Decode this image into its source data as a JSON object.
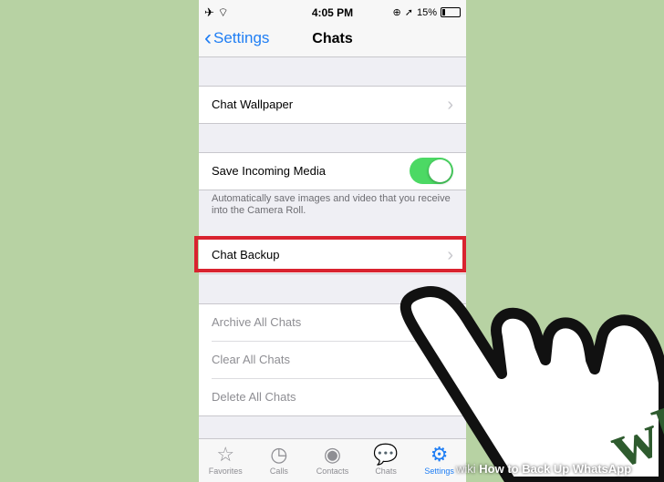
{
  "status_bar": {
    "time": "4:05 PM",
    "battery": "15%"
  },
  "nav": {
    "back_label": "Settings",
    "title": "Chats"
  },
  "groups": {
    "wallpaper": {
      "label": "Chat Wallpaper"
    },
    "media": {
      "label": "Save Incoming Media",
      "toggle_on": true,
      "footnote": "Automatically save images and video that you receive into the Camera Roll."
    },
    "backup": {
      "label": "Chat Backup"
    },
    "actions": [
      "Archive All Chats",
      "Clear All Chats",
      "Delete All Chats"
    ]
  },
  "tabs": [
    {
      "label": "Favorites",
      "icon": "star-icon"
    },
    {
      "label": "Calls",
      "icon": "clock-icon"
    },
    {
      "label": "Contacts",
      "icon": "person-icon"
    },
    {
      "label": "Chats",
      "icon": "chat-bubbles-icon"
    },
    {
      "label": "Settings",
      "icon": "gear-icon",
      "active": true
    }
  ],
  "colors": {
    "accent": "#1f7ef4",
    "toggle": "#4cd964",
    "highlight": "#d9232f",
    "background": "#b7d2a3"
  },
  "watermark": {
    "prefix": "wiki",
    "text": "How to Back Up WhatsApp"
  }
}
